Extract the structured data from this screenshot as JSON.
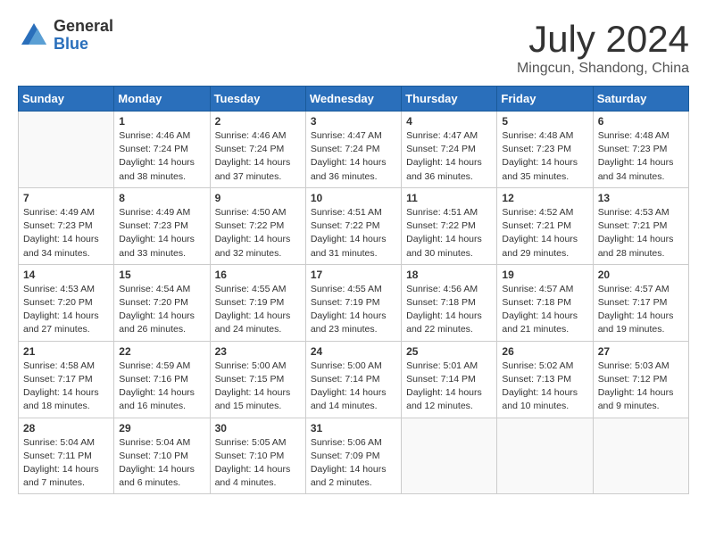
{
  "logo": {
    "general": "General",
    "blue": "Blue"
  },
  "title": "July 2024",
  "location": "Mingcun, Shandong, China",
  "days_of_week": [
    "Sunday",
    "Monday",
    "Tuesday",
    "Wednesday",
    "Thursday",
    "Friday",
    "Saturday"
  ],
  "weeks": [
    [
      {
        "day": "",
        "info": ""
      },
      {
        "day": "1",
        "info": "Sunrise: 4:46 AM\nSunset: 7:24 PM\nDaylight: 14 hours\nand 38 minutes."
      },
      {
        "day": "2",
        "info": "Sunrise: 4:46 AM\nSunset: 7:24 PM\nDaylight: 14 hours\nand 37 minutes."
      },
      {
        "day": "3",
        "info": "Sunrise: 4:47 AM\nSunset: 7:24 PM\nDaylight: 14 hours\nand 36 minutes."
      },
      {
        "day": "4",
        "info": "Sunrise: 4:47 AM\nSunset: 7:24 PM\nDaylight: 14 hours\nand 36 minutes."
      },
      {
        "day": "5",
        "info": "Sunrise: 4:48 AM\nSunset: 7:23 PM\nDaylight: 14 hours\nand 35 minutes."
      },
      {
        "day": "6",
        "info": "Sunrise: 4:48 AM\nSunset: 7:23 PM\nDaylight: 14 hours\nand 34 minutes."
      }
    ],
    [
      {
        "day": "7",
        "info": "Sunrise: 4:49 AM\nSunset: 7:23 PM\nDaylight: 14 hours\nand 34 minutes."
      },
      {
        "day": "8",
        "info": "Sunrise: 4:49 AM\nSunset: 7:23 PM\nDaylight: 14 hours\nand 33 minutes."
      },
      {
        "day": "9",
        "info": "Sunrise: 4:50 AM\nSunset: 7:22 PM\nDaylight: 14 hours\nand 32 minutes."
      },
      {
        "day": "10",
        "info": "Sunrise: 4:51 AM\nSunset: 7:22 PM\nDaylight: 14 hours\nand 31 minutes."
      },
      {
        "day": "11",
        "info": "Sunrise: 4:51 AM\nSunset: 7:22 PM\nDaylight: 14 hours\nand 30 minutes."
      },
      {
        "day": "12",
        "info": "Sunrise: 4:52 AM\nSunset: 7:21 PM\nDaylight: 14 hours\nand 29 minutes."
      },
      {
        "day": "13",
        "info": "Sunrise: 4:53 AM\nSunset: 7:21 PM\nDaylight: 14 hours\nand 28 minutes."
      }
    ],
    [
      {
        "day": "14",
        "info": "Sunrise: 4:53 AM\nSunset: 7:20 PM\nDaylight: 14 hours\nand 27 minutes."
      },
      {
        "day": "15",
        "info": "Sunrise: 4:54 AM\nSunset: 7:20 PM\nDaylight: 14 hours\nand 26 minutes."
      },
      {
        "day": "16",
        "info": "Sunrise: 4:55 AM\nSunset: 7:19 PM\nDaylight: 14 hours\nand 24 minutes."
      },
      {
        "day": "17",
        "info": "Sunrise: 4:55 AM\nSunset: 7:19 PM\nDaylight: 14 hours\nand 23 minutes."
      },
      {
        "day": "18",
        "info": "Sunrise: 4:56 AM\nSunset: 7:18 PM\nDaylight: 14 hours\nand 22 minutes."
      },
      {
        "day": "19",
        "info": "Sunrise: 4:57 AM\nSunset: 7:18 PM\nDaylight: 14 hours\nand 21 minutes."
      },
      {
        "day": "20",
        "info": "Sunrise: 4:57 AM\nSunset: 7:17 PM\nDaylight: 14 hours\nand 19 minutes."
      }
    ],
    [
      {
        "day": "21",
        "info": "Sunrise: 4:58 AM\nSunset: 7:17 PM\nDaylight: 14 hours\nand 18 minutes."
      },
      {
        "day": "22",
        "info": "Sunrise: 4:59 AM\nSunset: 7:16 PM\nDaylight: 14 hours\nand 16 minutes."
      },
      {
        "day": "23",
        "info": "Sunrise: 5:00 AM\nSunset: 7:15 PM\nDaylight: 14 hours\nand 15 minutes."
      },
      {
        "day": "24",
        "info": "Sunrise: 5:00 AM\nSunset: 7:14 PM\nDaylight: 14 hours\nand 14 minutes."
      },
      {
        "day": "25",
        "info": "Sunrise: 5:01 AM\nSunset: 7:14 PM\nDaylight: 14 hours\nand 12 minutes."
      },
      {
        "day": "26",
        "info": "Sunrise: 5:02 AM\nSunset: 7:13 PM\nDaylight: 14 hours\nand 10 minutes."
      },
      {
        "day": "27",
        "info": "Sunrise: 5:03 AM\nSunset: 7:12 PM\nDaylight: 14 hours\nand 9 minutes."
      }
    ],
    [
      {
        "day": "28",
        "info": "Sunrise: 5:04 AM\nSunset: 7:11 PM\nDaylight: 14 hours\nand 7 minutes."
      },
      {
        "day": "29",
        "info": "Sunrise: 5:04 AM\nSunset: 7:10 PM\nDaylight: 14 hours\nand 6 minutes."
      },
      {
        "day": "30",
        "info": "Sunrise: 5:05 AM\nSunset: 7:10 PM\nDaylight: 14 hours\nand 4 minutes."
      },
      {
        "day": "31",
        "info": "Sunrise: 5:06 AM\nSunset: 7:09 PM\nDaylight: 14 hours\nand 2 minutes."
      },
      {
        "day": "",
        "info": ""
      },
      {
        "day": "",
        "info": ""
      },
      {
        "day": "",
        "info": ""
      }
    ]
  ]
}
